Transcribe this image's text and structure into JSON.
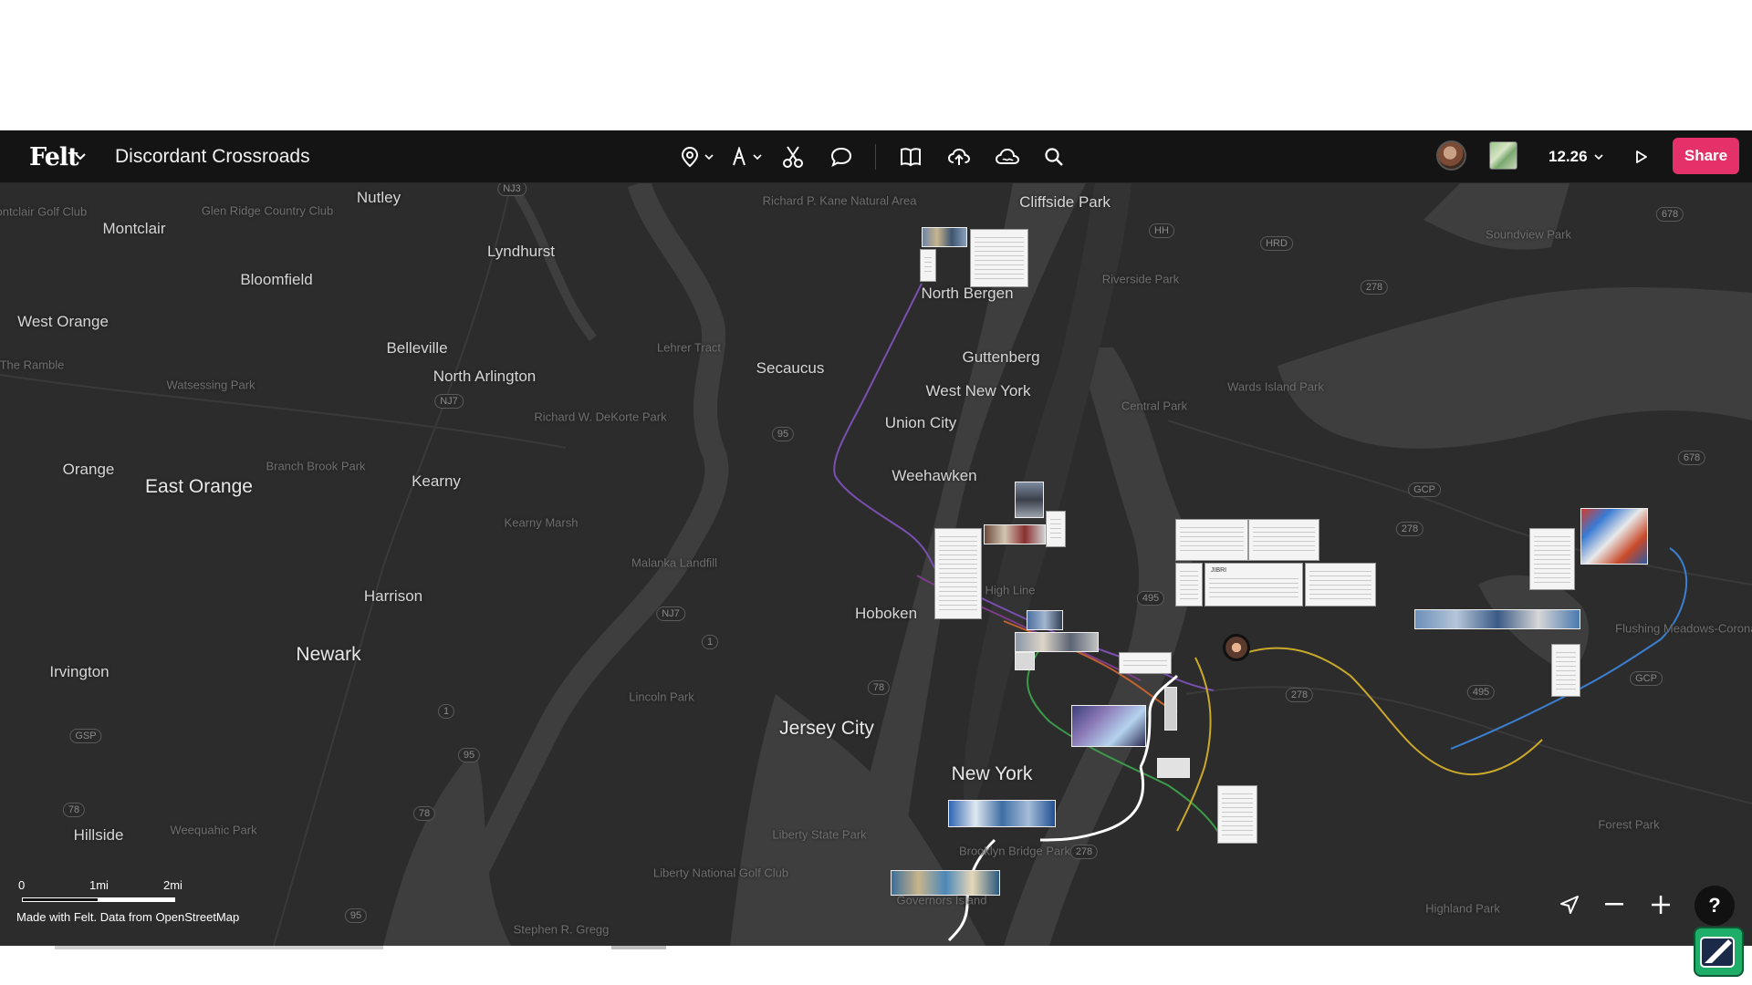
{
  "app": {
    "logo_text": "Felt",
    "map_title": "Discordant Crossroads",
    "zoom_level": "12.26",
    "share_label": "Share",
    "help_label": "?"
  },
  "toolbar": {
    "tools": [
      {
        "name": "pin-tool",
        "icon": "map-pin-icon",
        "has_menu": true
      },
      {
        "name": "text-tool",
        "icon": "text-icon",
        "has_menu": true
      },
      {
        "name": "cut-tool",
        "icon": "scissors-icon"
      },
      {
        "name": "comment-tool",
        "icon": "speech-bubble-icon"
      },
      {
        "name": "library-tool",
        "icon": "book-icon"
      },
      {
        "name": "upload-tool",
        "icon": "cloud-upload-icon"
      },
      {
        "name": "data-tool",
        "icon": "cloud-icon"
      },
      {
        "name": "search-tool",
        "icon": "search-icon"
      }
    ]
  },
  "map": {
    "places": [
      {
        "label": "Cliffside Park"
      },
      {
        "label": "North Bergen"
      },
      {
        "label": "Guttenberg"
      },
      {
        "label": "West New York"
      },
      {
        "label": "Union City"
      },
      {
        "label": "Weehawken"
      },
      {
        "label": "Hoboken"
      },
      {
        "label": "Jersey City"
      },
      {
        "label": "New York"
      },
      {
        "label": "Secaucus"
      },
      {
        "label": "Nutley"
      },
      {
        "label": "Montclair"
      },
      {
        "label": "Lyndhurst"
      },
      {
        "label": "Bloomfield"
      },
      {
        "label": "West Orange"
      },
      {
        "label": "Belleville"
      },
      {
        "label": "North Arlington"
      },
      {
        "label": "Orange"
      },
      {
        "label": "East Orange"
      },
      {
        "label": "Kearny"
      },
      {
        "label": "Harrison"
      },
      {
        "label": "Newark"
      },
      {
        "label": "Irvington"
      },
      {
        "label": "Hillside"
      }
    ],
    "dim_places": [
      {
        "label": "Montclair Golf Club"
      },
      {
        "label": "Glen Ridge Country Club"
      },
      {
        "label": "Richard P. Kane Natural Area"
      },
      {
        "label": "Soundview Park"
      },
      {
        "label": "Riverside Park"
      },
      {
        "label": "Wards Island Park"
      },
      {
        "label": "Central Park"
      },
      {
        "label": "Lehrer Tract"
      },
      {
        "label": "Richard W. DeKorte Park"
      },
      {
        "label": "The Ramble"
      },
      {
        "label": "Watsessing Park"
      },
      {
        "label": "Branch Brook Park"
      },
      {
        "label": "Kearny Marsh"
      },
      {
        "label": "Malanka Landfill"
      },
      {
        "label": "High Line"
      },
      {
        "label": "Lincoln Park"
      },
      {
        "label": "Weequahic Park"
      },
      {
        "label": "Liberty State Park"
      },
      {
        "label": "Liberty National Golf Club"
      },
      {
        "label": "Brooklyn Bridge Park"
      },
      {
        "label": "Governors Island"
      },
      {
        "label": "Stephen R. Gregg"
      },
      {
        "label": "Flushing Meadows-Corona Park"
      },
      {
        "label": "Forest Park"
      },
      {
        "label": "Highland Park"
      }
    ],
    "shields": [
      {
        "label": "NJ3"
      },
      {
        "label": "HH"
      },
      {
        "label": "HRD"
      },
      {
        "label": "278"
      },
      {
        "label": "678"
      },
      {
        "label": "678"
      },
      {
        "label": "NJ7"
      },
      {
        "label": "95"
      },
      {
        "label": "GCP"
      },
      {
        "label": "278"
      },
      {
        "label": "495"
      },
      {
        "label": "NJ7"
      },
      {
        "label": "1"
      },
      {
        "label": "78"
      },
      {
        "label": "278"
      },
      {
        "label": "495"
      },
      {
        "label": "GCP"
      },
      {
        "label": "1"
      },
      {
        "label": "GSP"
      },
      {
        "label": "95"
      },
      {
        "label": "78"
      },
      {
        "label": "78"
      },
      {
        "label": "278"
      },
      {
        "label": "95"
      }
    ],
    "note_text": "JIBRI"
  },
  "scale": {
    "zero": "0",
    "mid": "1mi",
    "end": "2mi"
  },
  "attribution": "Made with Felt. Data from OpenStreetMap",
  "colors": {
    "toolbar_bg": "#141414",
    "map_bg": "#2a2a2a",
    "land": "#2f2f2f",
    "water": "#3d3d3d",
    "share_accent": "#e5316a"
  }
}
